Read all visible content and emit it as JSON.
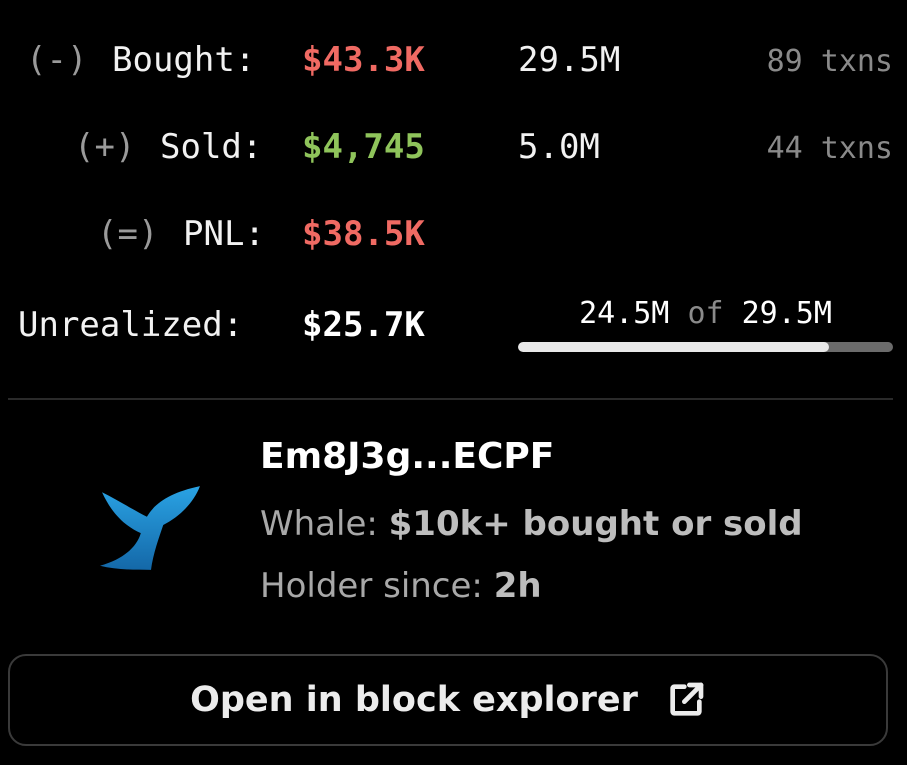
{
  "stats": {
    "bought": {
      "symbol": "(-)",
      "label": "Bought:",
      "value": "$43.3K",
      "amount": "29.5M",
      "txns": "89 txns"
    },
    "sold": {
      "symbol": "(+)",
      "label": "Sold:",
      "value": "$4,745",
      "amount": "5.0M",
      "txns": "44 txns"
    },
    "pnl": {
      "symbol": "(=)",
      "label": "PNL:",
      "value": "$38.5K"
    },
    "unrealized": {
      "label": "Unrealized:",
      "value": "$25.7K",
      "held": "24.5M",
      "of_word": "of",
      "total": "29.5M",
      "held_fraction": 0.83
    }
  },
  "wallet": {
    "address": "Em8J3g...ECPF",
    "icon": "whale-tail-icon",
    "category_label": "Whale:",
    "category_value": "$10k+ bought or sold",
    "holder_label": "Holder since:",
    "holder_value": "2h"
  },
  "actions": {
    "explorer_label": "Open in block explorer",
    "explorer_icon": "external-link-icon"
  },
  "colors": {
    "negative": "#f06a63",
    "positive": "#8fc45b",
    "whale_blue": "#1f8fd0"
  }
}
